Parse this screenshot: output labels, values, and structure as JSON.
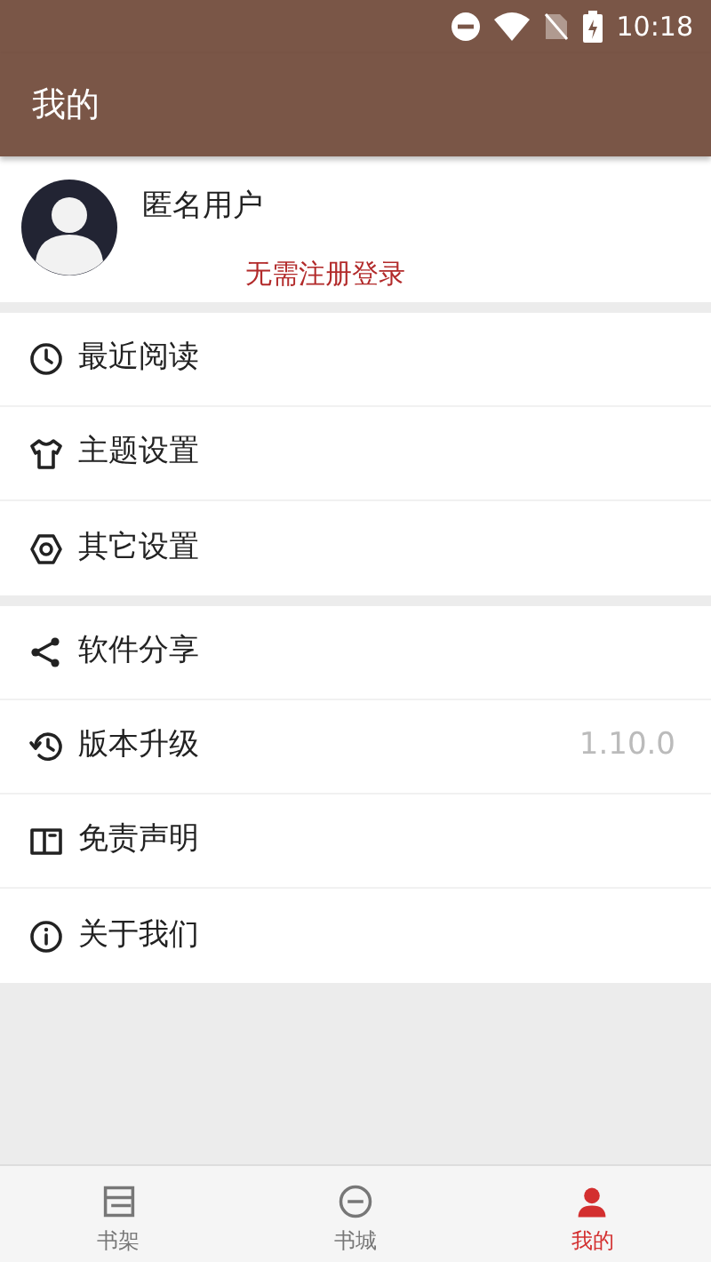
{
  "status_bar": {
    "time": "10:18"
  },
  "app_bar": {
    "title": "我的"
  },
  "profile": {
    "name": "匿名用户",
    "subtitle": "无需注册登录"
  },
  "menu_groups": [
    [
      {
        "label": "最近阅读"
      },
      {
        "label": "主题设置"
      },
      {
        "label": "其它设置"
      }
    ],
    [
      {
        "label": "软件分享"
      },
      {
        "label": "版本升级",
        "value": "1.10.0"
      },
      {
        "label": "免责声明"
      },
      {
        "label": "关于我们"
      }
    ]
  ],
  "bottom_nav": [
    {
      "label": "书架",
      "selected": false
    },
    {
      "label": "书城",
      "selected": false
    },
    {
      "label": "我的",
      "selected": true
    }
  ]
}
